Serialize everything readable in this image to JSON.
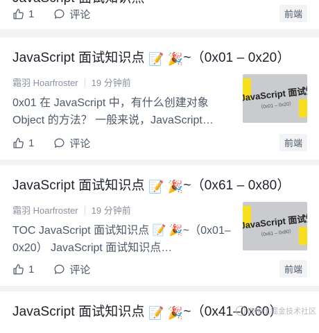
{
  "feed": {
    "partial_top": {
      "title": "JavaScript 面试知识点",
      "likes": "1",
      "comment_label": "评论",
      "tag": "前端"
    },
    "articles": [
      {
        "title": "JavaScript 面试知识点",
        "emoji_1": "📝",
        "emoji_2": "🎉",
        "range": "~（0x01 – 0x20）",
        "author": "霜羽 Hoarfroster",
        "time": "19 分钟前",
        "excerpt": "0x01 在 JavaScript 中，有什么创建对象 Object 的方法？ 一般来说，JavaScript…",
        "thumb_text": "JavaScript 面试知识",
        "thumb_sub": "（0x01 – 0x20）",
        "likes": "1",
        "comment_label": "评论",
        "tag": "前端"
      },
      {
        "title": "JavaScript 面试知识点",
        "emoji_1": "📝",
        "emoji_2": "🎉",
        "range": "~（0x61 – 0x80）",
        "author": "霜羽 Hoarfroster",
        "time": "19 分钟前",
        "excerpt": "TOC JavaScript 面试知识点 📝 🎉~（0x01–0x20） JavaScript 面试知识点…",
        "thumb_text": "JavaScript 面试知识",
        "thumb_sub": "（0x61 – 0x80）",
        "likes": "1",
        "comment_label": "评论",
        "tag": "前端"
      },
      {
        "title": "JavaScript 面试知识点",
        "emoji_1": "📝",
        "emoji_2": "🎉",
        "range": "~（0x41–0x60）"
      }
    ]
  },
  "watermark": "@稀土掘金技术社区",
  "icons": {
    "like": "thumbs-up-icon",
    "comment": "comment-bubble-icon"
  }
}
